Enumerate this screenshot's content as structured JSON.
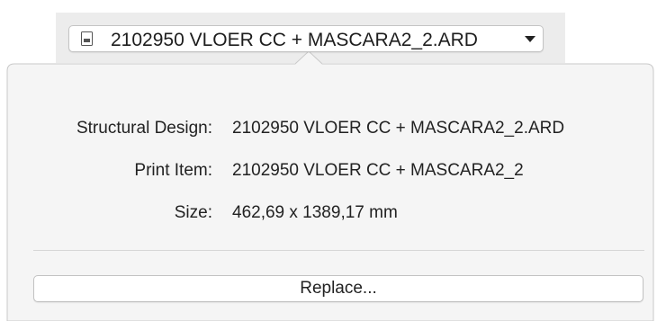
{
  "toolbar": {
    "file_popup": {
      "label": "2102950 VLOER CC + MASCARA2_2.ARD",
      "icon": "document-icon",
      "chevron": "chevron-down-icon"
    }
  },
  "popover": {
    "fields": [
      {
        "label": "Structural Design:",
        "value": "2102950 VLOER CC + MASCARA2_2.ARD"
      },
      {
        "label": "Print Item:",
        "value": "2102950 VLOER CC + MASCARA2_2"
      },
      {
        "label": "Size:",
        "value": "462,69 x 1389,17 mm"
      }
    ],
    "replace_label": "Replace..."
  },
  "colors": {
    "toolbar_background": "#ececec",
    "popover_background": "#f5f5f5",
    "popover_border": "#c9c9c9",
    "text": "#222222"
  }
}
